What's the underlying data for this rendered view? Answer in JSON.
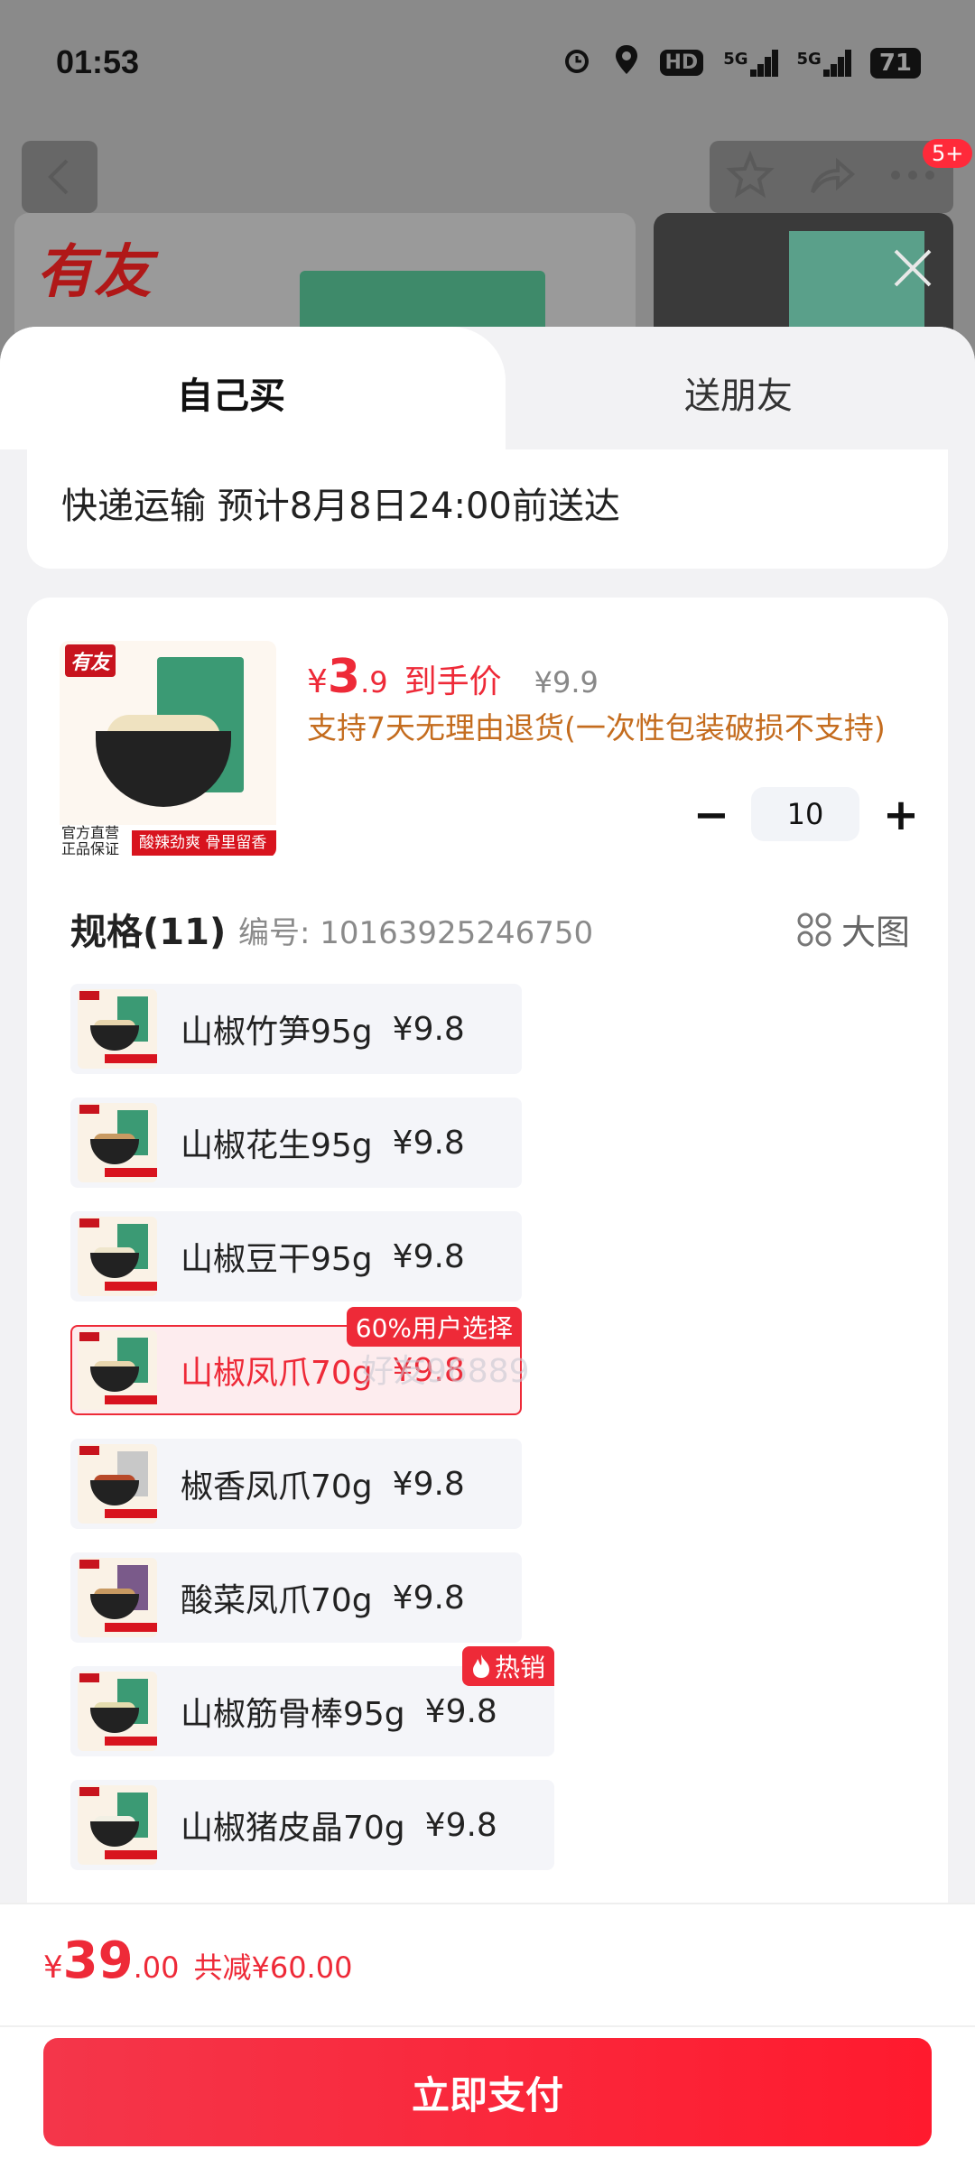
{
  "status_bar": {
    "time": "01:53",
    "network_label": "HD",
    "network_1": "5G",
    "network_2": "5G",
    "battery": "71"
  },
  "header": {
    "notification_badge": "5+",
    "brand_logo": "有友"
  },
  "tabs": [
    {
      "label": "自己买",
      "active": true
    },
    {
      "label": "送朋友",
      "active": false
    }
  ],
  "delivery": {
    "text": "快递运输 预计8月8日24:00前送达"
  },
  "product": {
    "thumb_logo": "有友",
    "thumb_left_text": "官方直营 正品保证",
    "thumb_red_text": "酸辣劲爽 骨里留香",
    "currency": "¥",
    "price_int": "3",
    "price_dec": ".9",
    "price_tag": "到手价",
    "original_price": "¥9.9",
    "return_policy": "支持7天无理由退货(一次性包装破损不支持)",
    "quantity": "10",
    "minus_symbol": "−",
    "plus_symbol": "+"
  },
  "spec": {
    "title": "规格(11)",
    "code": "编号: 10163925246750",
    "big_image_label": "大图",
    "items": [
      {
        "name": "山椒竹笋95g",
        "price": "¥9.8",
        "selected": false
      },
      {
        "name": "山椒花生95g",
        "price": "¥9.8",
        "selected": false
      },
      {
        "name": "山椒豆干95g",
        "price": "¥9.8",
        "selected": false
      },
      {
        "name": "山椒凤爪70g",
        "price": "¥9.8",
        "selected": true,
        "badge": "60%用户选择"
      },
      {
        "name": "椒香凤爪70g",
        "price": "¥9.8",
        "selected": false
      },
      {
        "name": "酸菜凤爪70g",
        "price": "¥9.8",
        "selected": false
      },
      {
        "name": "山椒筋骨棒95g",
        "price": "¥9.8",
        "selected": false,
        "badge": "热销"
      },
      {
        "name": "山椒猪皮晶70g",
        "price": "¥9.8",
        "selected": false
      }
    ]
  },
  "watermark": "好友96889",
  "footer": {
    "currency": "¥",
    "total_int": "39",
    "total_dec": ".00",
    "discount": "共减¥60.00",
    "pay_button": "立即支付"
  },
  "colors": {
    "accent": "#ee2a38",
    "policy": "#c46c1e"
  }
}
